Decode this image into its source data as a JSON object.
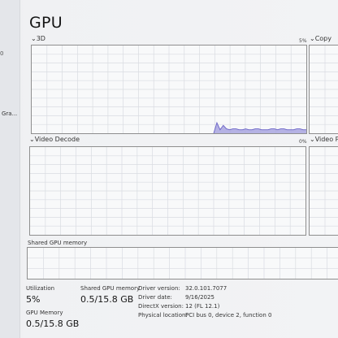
{
  "page": {
    "title": "GPU",
    "left_strip_number": "0",
    "left_strip_item": "Gra..."
  },
  "graphs": {
    "engine_3d": {
      "label": "3D",
      "percent": "5%"
    },
    "copy": {
      "label": "Copy"
    },
    "video_decode": {
      "label": "Video Decode",
      "percent": "0%"
    },
    "video_processing": {
      "label": "Video Pr"
    }
  },
  "shared_memory_graph": {
    "label": "Shared GPU memory"
  },
  "stats": {
    "utilization": {
      "label": "Utilization",
      "value": "5%"
    },
    "shared_gpu_memory": {
      "label": "Shared GPU memory",
      "value": "0.5/15.8 GB"
    },
    "gpu_memory": {
      "label": "GPU Memory",
      "value": "0.5/15.8 GB"
    }
  },
  "info": {
    "driver_version": {
      "key": "Driver version:",
      "value": "32.0.101.7077"
    },
    "driver_date": {
      "key": "Driver date:",
      "value": "9/16/2025"
    },
    "directx_version": {
      "key": "DirectX version:",
      "value": "12 (FL 12.1)"
    },
    "physical_location": {
      "key": "Physical location:",
      "value": "PCI bus 0, device 2, function 0"
    }
  },
  "colors": {
    "graph_fill": "#a9a6df",
    "graph_line": "#6a63c7",
    "grid": "#d9dce1"
  },
  "usage_history_3d": [
    0,
    0,
    0,
    0,
    0,
    0,
    0,
    0,
    0,
    0,
    0,
    0,
    0,
    0,
    0,
    0,
    0,
    0,
    0,
    0,
    0,
    0,
    0,
    0,
    0,
    0,
    0,
    0,
    0,
    0,
    0,
    0,
    0,
    0,
    0,
    0,
    0,
    0,
    0,
    0,
    0,
    0,
    0,
    0,
    0,
    0,
    0,
    0,
    0,
    0,
    0,
    0,
    0,
    0,
    0,
    0,
    0,
    0,
    12,
    4,
    9,
    5,
    4,
    5,
    5,
    4,
    4,
    5,
    4,
    4,
    5,
    5,
    4,
    4,
    4,
    5,
    5,
    4,
    5,
    5,
    4,
    4,
    4,
    5,
    5,
    4,
    4
  ]
}
